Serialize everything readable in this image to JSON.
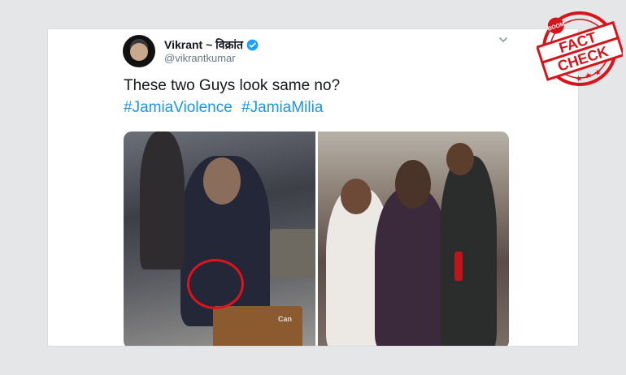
{
  "tweet": {
    "display_name": "Vikrant ~ विक्रांत",
    "handle": "@vikrantkumar",
    "text": "These two Guys look same no?",
    "hashtags": [
      "#JamiaViolence",
      "#JamiaMilia"
    ]
  },
  "media": {
    "left_photo_caption": "Can"
  },
  "stamp": {
    "brand": "BOOM",
    "line1": "FACT",
    "line2": "CHECK"
  },
  "colors": {
    "link": "#1b95e0",
    "verified": "#1da1f2",
    "stamp_red": "#d7141c",
    "highlight_circle": "#e0131a"
  }
}
